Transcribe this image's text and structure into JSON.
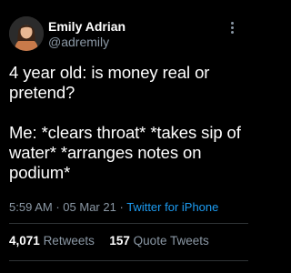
{
  "author": {
    "display_name": "Emily Adrian",
    "handle": "@adremily"
  },
  "tweet": {
    "line1": "4 year old: is money real or pretend?",
    "line2": "Me: *clears throat* *takes sip of water* *arranges notes on podium*",
    "time": "5:59 AM",
    "separator": "·",
    "date": "05 Mar 21",
    "source": "Twitter for iPhone"
  },
  "stats": {
    "retweets_count": "4,071",
    "retweets_label": "Retweets",
    "quotes_count": "157",
    "quotes_label": "Quote Tweets"
  },
  "icons": {
    "more": "more-vertical-icon"
  },
  "colors": {
    "background": "#000000",
    "text": "#ffffff",
    "secondary": "#8b98a5",
    "link": "#1d9bf0",
    "divider": "#2f3336"
  }
}
